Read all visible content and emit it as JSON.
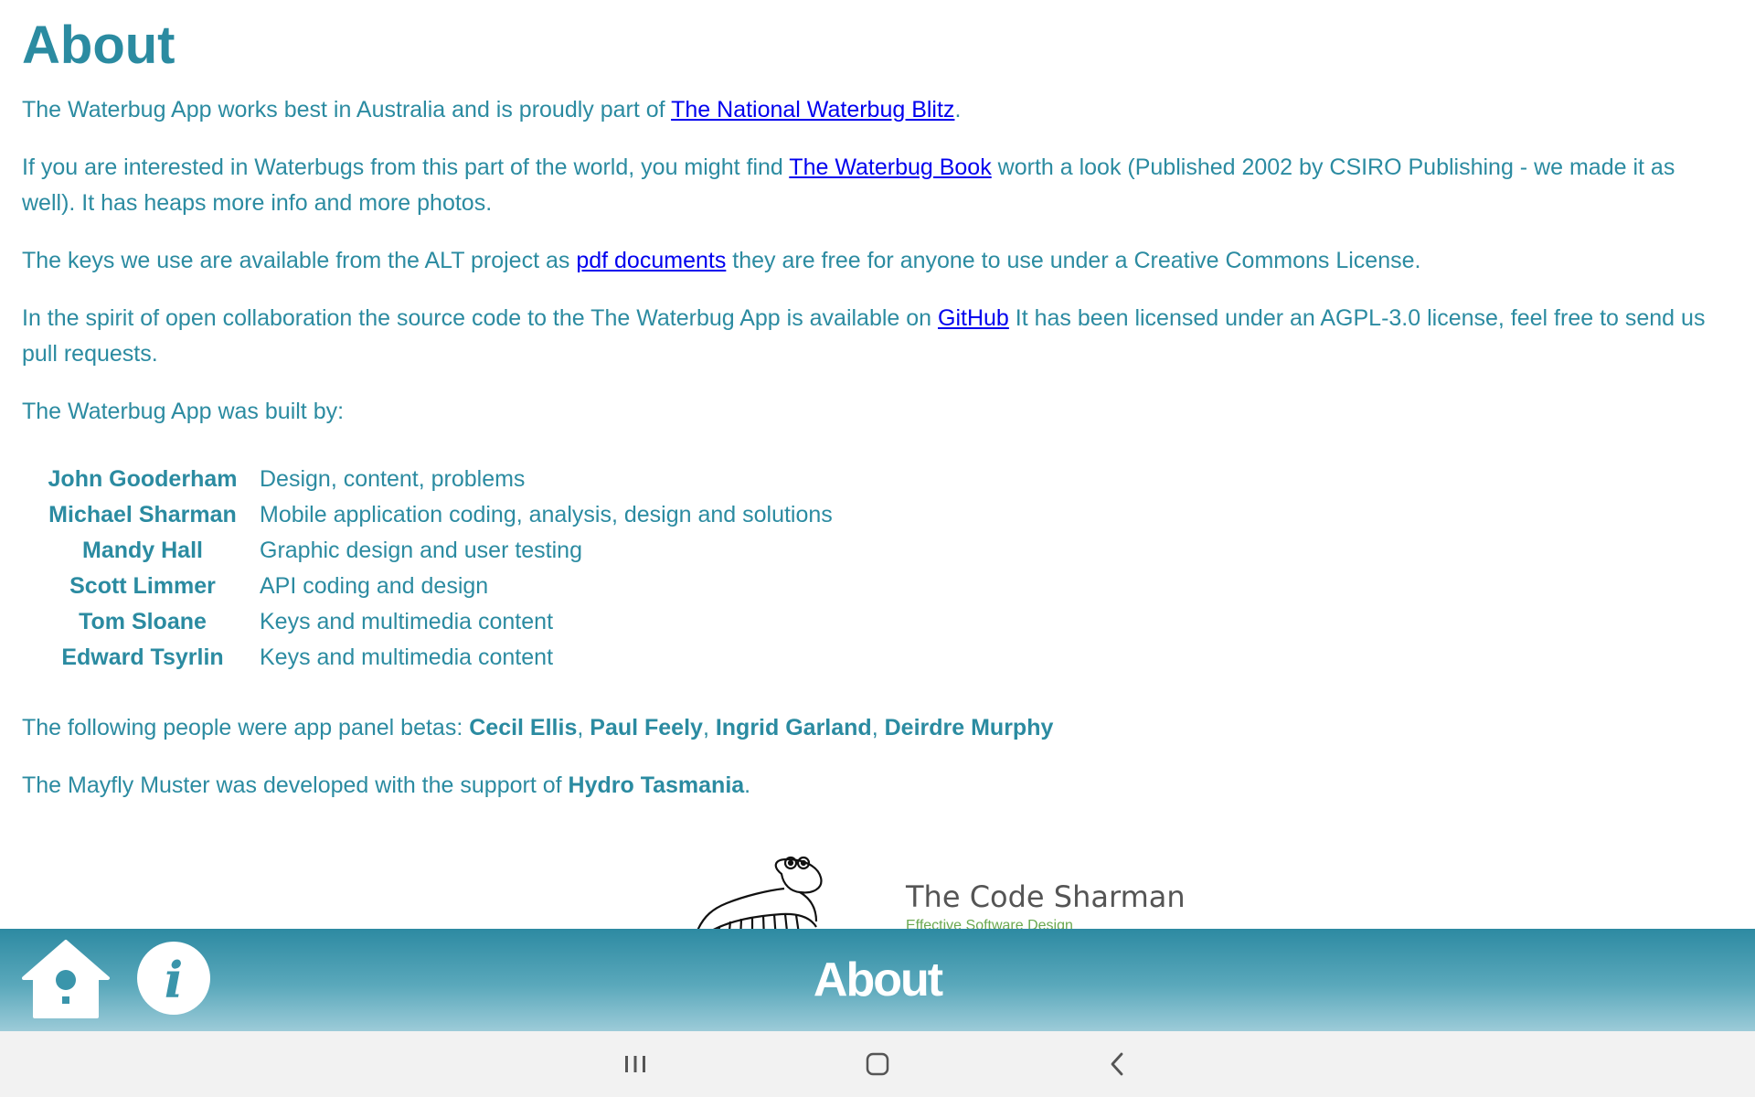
{
  "page": {
    "title": "About"
  },
  "intro": {
    "p1_text": "The Waterbug App works best in Australia and is proudly part of ",
    "p1_link": "The National Waterbug Blitz",
    "p1_end": ".",
    "p2_text": "If you are interested in Waterbugs from this part of the world, you might find ",
    "p2_link": "The Waterbug Book",
    "p2_end": " worth a look (Published 2002 by CSIRO Publishing - we made it as well). It has heaps more info and more photos.",
    "p3_text": "The keys we use are available from the ALT project as ",
    "p3_link": "pdf documents",
    "p3_end": " they are free for anyone to use under a Creative Commons License.",
    "p4_text": "In the spirit of open collaboration the source code to the The Waterbug App is available on ",
    "p4_link": "GitHub",
    "p4_end": " It has been licensed under an AGPL-3.0 license, feel free to send us pull requests.",
    "p5_text": "The Waterbug App was built by:"
  },
  "credits": [
    {
      "name": "John Gooderham",
      "role": "Design, content, problems"
    },
    {
      "name": "Michael Sharman",
      "role": "Mobile application coding, analysis, design and solutions"
    },
    {
      "name": "Mandy Hall",
      "role": "Graphic design and user testing"
    },
    {
      "name": "Scott Limmer",
      "role": "API coding and design"
    },
    {
      "name": "Tom Sloane",
      "role": "Keys and multimedia content"
    },
    {
      "name": "Edward Tsyrlin",
      "role": "Keys and multimedia content"
    }
  ],
  "betas": {
    "prefix": "The following people were app panel betas: ",
    "people": [
      "Cecil Ellis",
      "Paul Feely",
      "Ingrid Garland",
      "Deirdre Murphy"
    ],
    "sep": ", "
  },
  "support": {
    "prefix": "The Mayfly Muster was developed with the support of ",
    "org": "Hydro Tasmania",
    "end": "."
  },
  "logo": {
    "title": "The Code Sharman",
    "tagline": "Effective Software Design"
  },
  "bottom_bar": {
    "title": "About",
    "home_icon": "home-icon",
    "info_icon": "info-icon",
    "color_top": "#2d8aa2",
    "color_bottom": "#9ccbd8"
  },
  "nav": {
    "recents_icon": "recents-icon",
    "home_icon": "nav-home-icon",
    "back_icon": "back-icon"
  },
  "colors": {
    "text": "#2b8ba1",
    "link": "#0000ee"
  }
}
